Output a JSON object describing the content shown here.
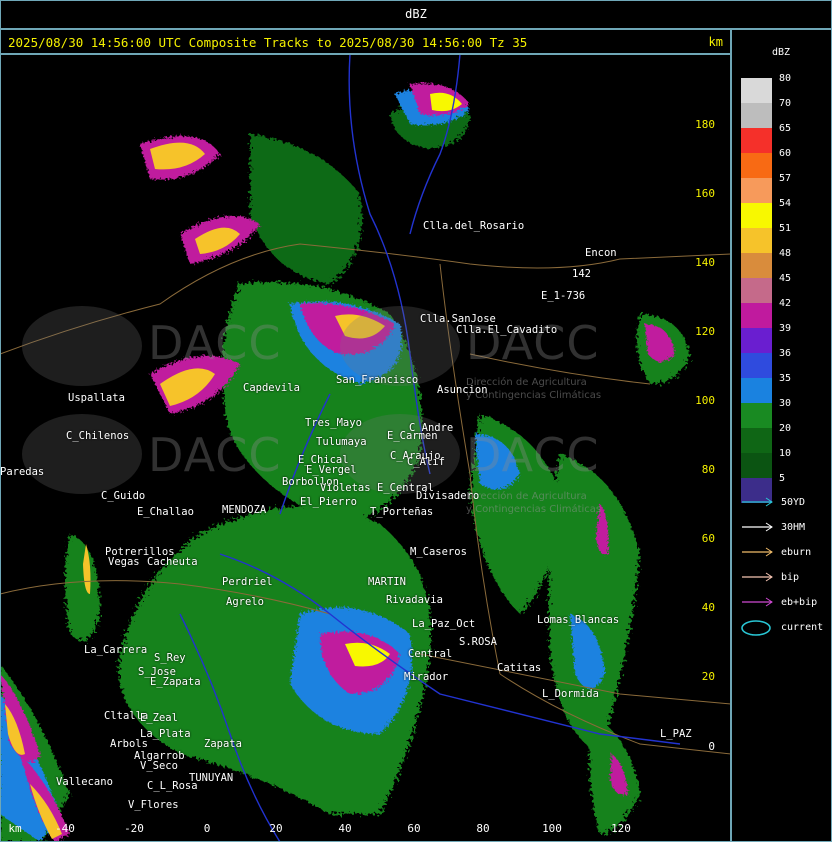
{
  "window_title": "dBZ",
  "header": "2025/08/30 14:56:00 UTC Composite Tracks to 2025/08/30 14:56:00 Tz 35",
  "header_unit": "km",
  "axes": {
    "x_unit": "km",
    "x_ticks": [
      "-40",
      "-20",
      "0",
      "20",
      "40",
      "60",
      "80",
      "100",
      "120"
    ],
    "y_ticks": [
      "180",
      "160",
      "140",
      "120",
      "100",
      "80",
      "60",
      "40",
      "20",
      "0"
    ]
  },
  "places": [
    "Clla.del_Rosario",
    "Encon",
    "142",
    "E_1-736",
    "Clla.SanJose",
    "Clla.El_Cavadito",
    "Uspallata",
    "Capdevila",
    "San_Francisco",
    "Asuncion",
    "Tres_Mayo",
    "Tulumaya",
    "E_Carmen",
    "C_Andre",
    "C_Chilenos",
    "E_Chical",
    "E_Vergel",
    "C_Araujo",
    "C_Alif",
    "Paredas",
    "Borbollon",
    "El_Pierro",
    "Violetas",
    "E_Central",
    "Divisadero",
    "C_Guido",
    "E_Challao",
    "MENDOZA",
    "T_Porteñas",
    "Potrerillos",
    "Cacheuta",
    "Vegas",
    "M_Caseros",
    "MARTIN",
    "Rivadavia",
    "La_Paz_Oct",
    "S.ROSA",
    "La_Carrera",
    "S_Rey",
    "Central",
    "Mirador",
    "Catitas",
    "E_Zapata",
    "Lomas_Blancas",
    "L_Dormida",
    "Cltalla",
    "E_Zeal",
    "La_Plata",
    "Arbols",
    "Algarrob",
    "V_Seco",
    "Zapata",
    "TUNUYAN",
    "C_L_Rosa",
    "Vallecano",
    "V_Flores",
    "L_PAZ",
    "S_Jose",
    "Agrelo",
    "Perdriel"
  ],
  "watermark": {
    "brand": "DACC",
    "subtitle_line1": "Dirección de Agricultura",
    "subtitle_line2": "y Contingencias Climáticas"
  },
  "legend": {
    "title": "dBZ",
    "scale": [
      {
        "label": "80",
        "color": "#d9d9d9"
      },
      {
        "label": "70",
        "color": "#bdbdbd"
      },
      {
        "label": "65",
        "color": "#f5302a"
      },
      {
        "label": "60",
        "color": "#f86a14"
      },
      {
        "label": "57",
        "color": "#f79a5b"
      },
      {
        "label": "54",
        "color": "#f8f800"
      },
      {
        "label": "51",
        "color": "#f6c32a"
      },
      {
        "label": "48",
        "color": "#d98c3c"
      },
      {
        "label": "45",
        "color": "#c56a8a"
      },
      {
        "label": "42",
        "color": "#c01a9e"
      },
      {
        "label": "39",
        "color": "#6a1ed0"
      },
      {
        "label": "36",
        "color": "#2f4bde"
      },
      {
        "label": "35",
        "color": "#1a82e0"
      },
      {
        "label": "30",
        "color": "#198a22"
      },
      {
        "label": "20",
        "color": "#0f6615"
      },
      {
        "label": "10",
        "color": "#0b5412"
      },
      {
        "label": "5",
        "color": "#3c2d8a"
      }
    ],
    "tracks": [
      {
        "label": "50YD",
        "color": "#29c6d4"
      },
      {
        "label": "30HM",
        "color": "#ffffff"
      },
      {
        "label": "eburn",
        "color": "#f1bd6a"
      },
      {
        "label": "bip",
        "color": "#f7c6b4"
      },
      {
        "label": "eb+bip",
        "color": "#d04ad4"
      },
      {
        "label": "current",
        "color": "#29c6d4"
      }
    ]
  }
}
